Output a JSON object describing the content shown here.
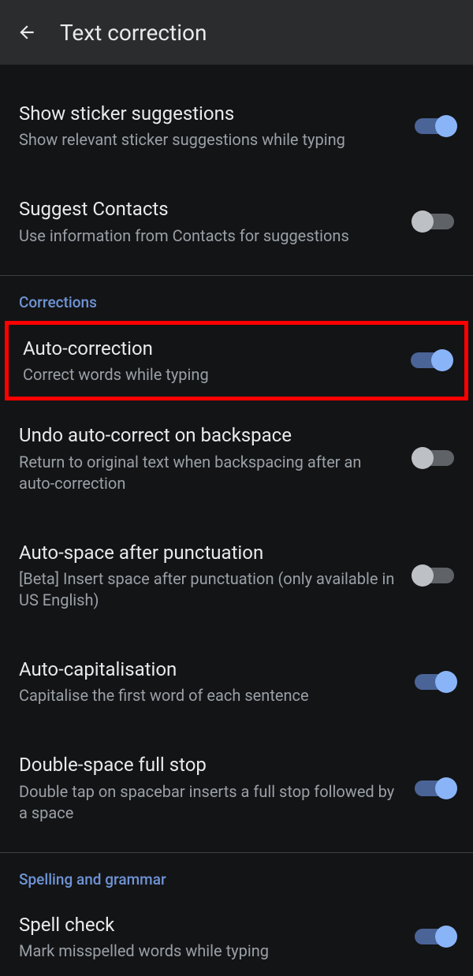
{
  "header": {
    "title": "Text correction"
  },
  "settings": {
    "sticker": {
      "title": "Show sticker suggestions",
      "subtitle": "Show relevant sticker suggestions while typing"
    },
    "contacts": {
      "title": "Suggest Contacts",
      "subtitle": "Use information from Contacts for suggestions"
    },
    "autocorrect": {
      "title": "Auto-correction",
      "subtitle": "Correct words while typing"
    },
    "undo": {
      "title": "Undo auto-correct on backspace",
      "subtitle": "Return to original text when backspacing after an auto-correction"
    },
    "autospace": {
      "title": "Auto-space after punctuation",
      "subtitle": "[Beta] Insert space after punctuation (only available in US English)"
    },
    "autocap": {
      "title": "Auto-capitalisation",
      "subtitle": "Capitalise the first word of each sentence"
    },
    "doublespace": {
      "title": "Double-space full stop",
      "subtitle": "Double tap on spacebar inserts a full stop followed by a space"
    },
    "spellcheck": {
      "title": "Spell check",
      "subtitle": "Mark misspelled words while typing"
    }
  },
  "sections": {
    "corrections": "Corrections",
    "spelling": "Spelling and grammar"
  }
}
